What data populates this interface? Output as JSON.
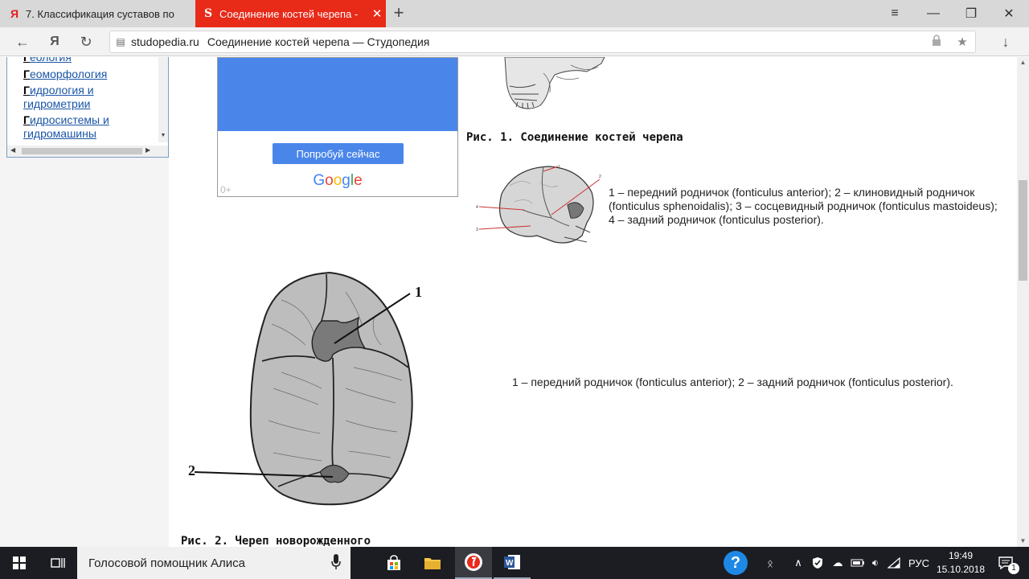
{
  "browser": {
    "tabs": [
      {
        "favicon": "Я",
        "title": "7. Классификация суставов по"
      },
      {
        "favicon": "S",
        "title": "Соединение костей черепа -",
        "close": "✕"
      }
    ],
    "new_tab": "+",
    "window_controls": {
      "menu": "≡",
      "minimize": "—",
      "restore": "❐",
      "close": "✕"
    },
    "nav": {
      "back": "←",
      "yandex": "Я",
      "reload": "↻",
      "download": "↓"
    },
    "address": {
      "domain": "studopedia.ru",
      "title": "Соединение костей черепа — Студопедия",
      "lock_icon": "🔒",
      "star_icon": "★"
    }
  },
  "sidebar": {
    "categories": [
      {
        "first": "Г",
        "rest": "еология"
      },
      {
        "first": "Г",
        "rest": "еоморфология"
      },
      {
        "first": "Г",
        "rest": "идрология и гидрометрии"
      },
      {
        "first": "Г",
        "rest": "идросистемы и гидромашины"
      }
    ]
  },
  "ad": {
    "cta": "Попробуй сейчас",
    "logo_letters": [
      "G",
      "o",
      "o",
      "g",
      "l",
      "e"
    ],
    "logo_colors": [
      "#4285f4",
      "#ea4335",
      "#fbbc05",
      "#4285f4",
      "#34a853",
      "#ea4335"
    ],
    "age": "0+"
  },
  "article": {
    "fig1_caption": "Рис. 1. Соединение костей черепа",
    "fig1_desc": "1 – передний родничок (fonticulus anterior); 2 – клиновидный родничок (fonticulus sphenoidalis); 3 – сосцевидный родничок (fonticulus mastoideus); 4 – задний родничок (fonticulus posterior).",
    "fig1_labels": [
      "1",
      "2",
      "3",
      "4"
    ],
    "fig2_desc": "1 – передний родничок (fonticulus anterior); 2 – задний родничок (fonticulus posterior).",
    "fig2_labels": [
      "1",
      "2"
    ],
    "fig2_caption": "Рис. 2. Череп новорожденного"
  },
  "taskbar": {
    "search_placeholder": "Голосовой помощник Алиса",
    "language": "РУС",
    "time": "19:49",
    "date": "15.10.2018",
    "notifications": "1",
    "help": "?"
  },
  "colors": {
    "tab_active": "#e82a19",
    "link": "#1a55a6",
    "ad_blue": "#4a86ea",
    "taskbar": "#1c1d22"
  }
}
